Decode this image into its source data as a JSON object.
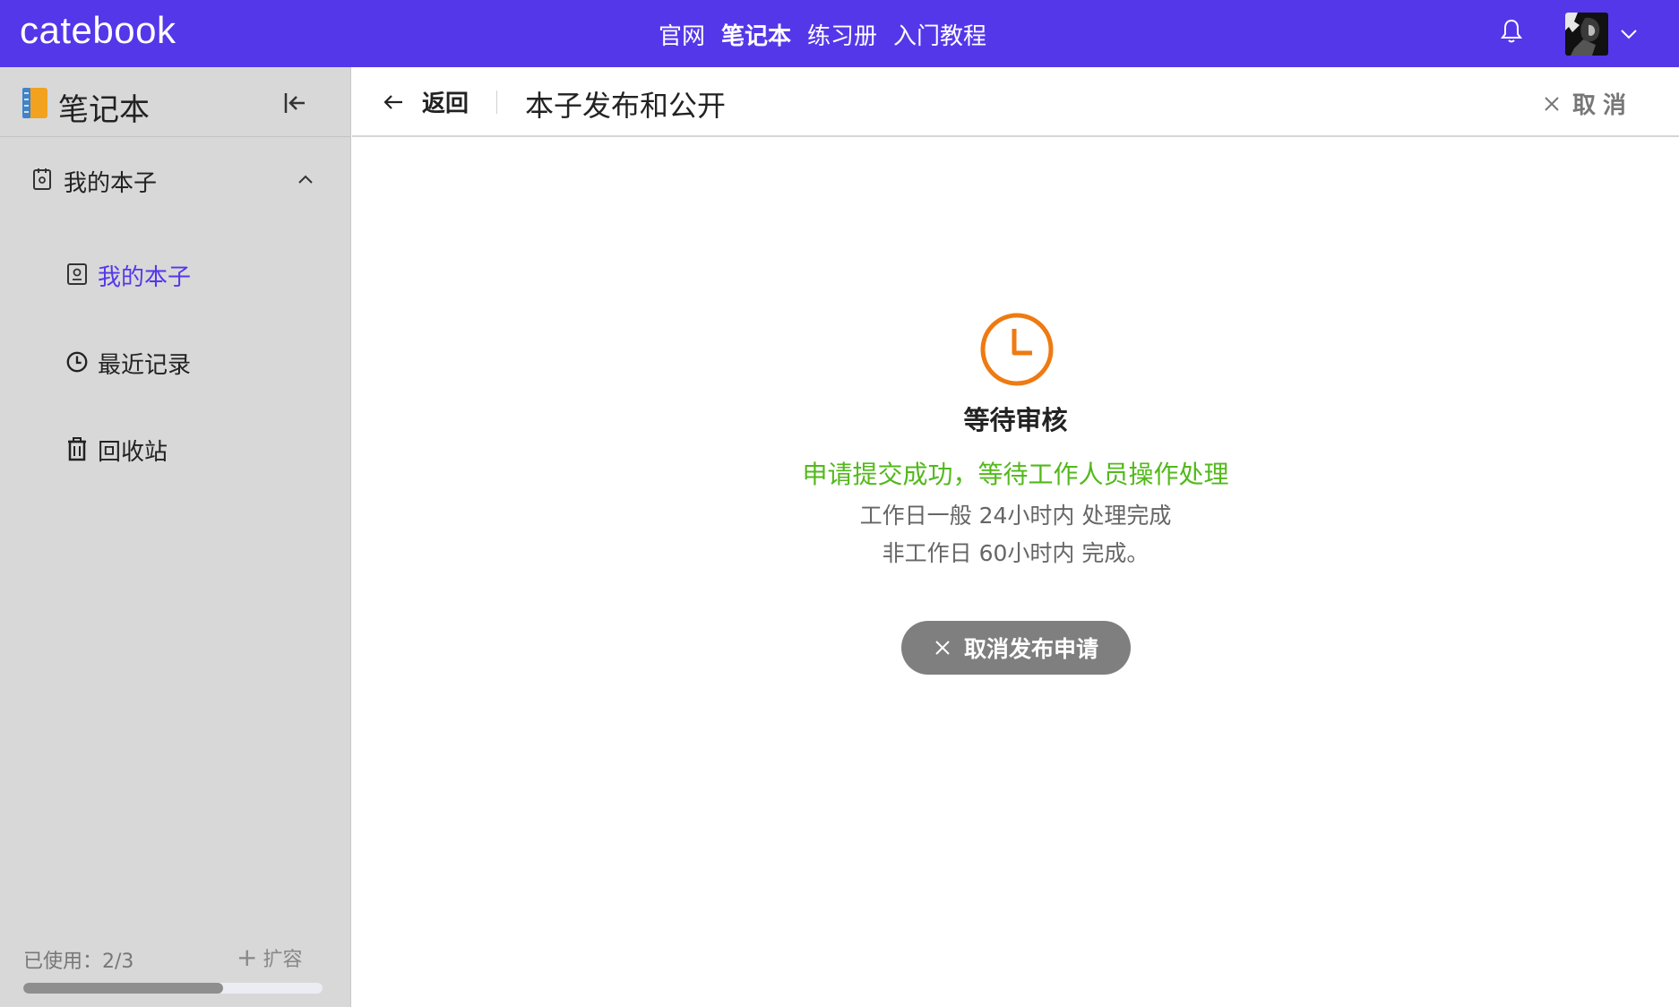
{
  "app": {
    "logo": "catebook"
  },
  "nav": {
    "items": [
      "官网",
      "笔记本",
      "练习册",
      "入门教程"
    ],
    "active_index": 1
  },
  "sidebar": {
    "title": "笔记本",
    "group": {
      "label": "我的本子"
    },
    "items": [
      {
        "label": "我的本子",
        "icon": "notebook-icon",
        "active": true
      },
      {
        "label": "最近记录",
        "icon": "clock-icon",
        "active": false
      },
      {
        "label": "回收站",
        "icon": "trash-icon",
        "active": false
      }
    ],
    "usage": {
      "label": "已使用：2/3",
      "fraction": 0.667
    },
    "expand_label": "扩容"
  },
  "header": {
    "back_label": "返回",
    "title": "本子发布和公开",
    "cancel_label": "取消"
  },
  "status": {
    "title": "等待审核",
    "message": "申请提交成功，等待工作人员操作处理",
    "line1": "工作日一般 24小时内 处理完成",
    "line2": "非工作日 60小时内 完成。",
    "cancel_button": "取消发布申请"
  },
  "colors": {
    "brand": "#5537ea",
    "sidebar_bg": "#d8d8d8",
    "success": "#52b91a",
    "pending": "#ef7a11",
    "button_gray": "#7f7f7f"
  }
}
